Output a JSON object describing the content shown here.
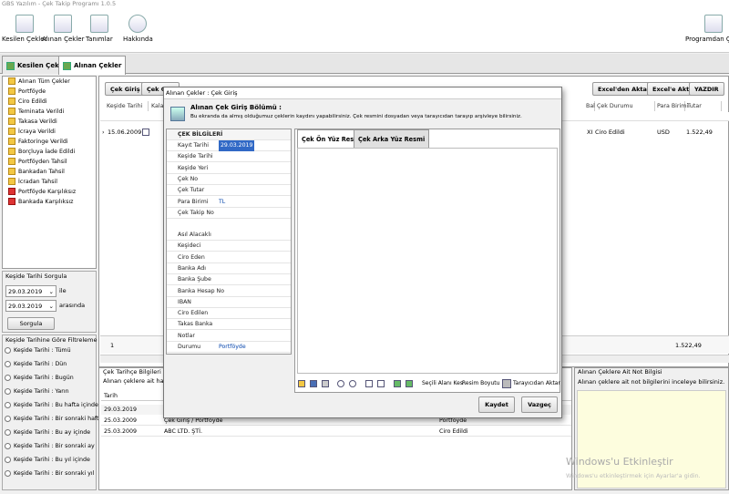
{
  "window": {
    "title": "GBS Yazılım - Çek Takip Programı 1.0.5"
  },
  "ribbon": {
    "kesilen": "Kesilen Çekler",
    "alinan": "Alınan Çekler",
    "tanimlar": "Tanımlar",
    "hakkinda": "Hakkında",
    "exit": "Programdan Çıkış"
  },
  "tabs": [
    "Kesilen Çekler",
    "Alınan Çekler"
  ],
  "tree": [
    "Alınan Tüm Çekler",
    "Portföyde",
    "Ciro Edildi",
    "Teminata Verildi",
    "Takasa Verildi",
    "İcraya Verildi",
    "Faktoringe Verildi",
    "Borçluya İade Edildi",
    "Portföyden Tahsil",
    "Bankadan Tahsil",
    "İcradan Tahsil",
    "Portföyde Karşılıksız",
    "Bankada Karşılıksız"
  ],
  "date_query": {
    "title": "Keşide Tarihi Sorgula",
    "from": "29.03.2019",
    "from_suffix": "ile",
    "to": "29.03.2019",
    "to_suffix": "arasında",
    "button": "Sorgula"
  },
  "filter": {
    "title": "Keşide Tarihine Göre Filtreleme",
    "options": [
      "Keşide Tarihi : Tümü",
      "Keşide Tarihi : Dün",
      "Keşide Tarihi : Bugün",
      "Keşide Tarihi : Yarın",
      "Keşide Tarihi : Bu hafta içinde",
      "Keşide Tarihi : Bir sonraki hafta",
      "Keşide Tarihi : Bu ay içinde",
      "Keşide Tarihi : Bir sonraki ay",
      "Keşide Tarihi : Bu yıl içinde",
      "Keşide Tarihi : Bir sonraki yıl"
    ]
  },
  "toolbar": {
    "cek_giris": "Çek Giriş",
    "cek_guncelle": "Çek Gün",
    "excel_aktar": "Excel'den Aktar",
    "excel_e": "Excel'e Aktar",
    "yazdir": "YAZDIR"
  },
  "grid": {
    "columns": [
      "Keşide Tarihi",
      "Kalan",
      "Bal",
      "Çek Durumu",
      "Para Birimi",
      "Tutar"
    ],
    "row": {
      "tarih": "15.06.2009",
      "x": "XI",
      "durum": "Ciro Edildi",
      "para": "USD",
      "tutar": "1.522,49"
    },
    "footer_count": "1",
    "footer_total": "1.522,49"
  },
  "history": {
    "title": "Çek Tarihçe Bilgileri",
    "info": "Alınan çeklere ait hareketl",
    "col": "Tarih",
    "group": "29.03.2019",
    "rows": [
      {
        "tarih": "25.03.2009",
        "islem": "Çek Giriş / Portföyde",
        "durum": "Portföyde"
      },
      {
        "tarih": "25.03.2009",
        "islem": "ABC LTD. ŞTİ.",
        "durum": "Ciro Edildi"
      }
    ]
  },
  "notes": {
    "title": "Alınan Çeklere Ait Not Bilgisi",
    "info": "Alınan çeklere ait not bilgilerini inceleye bilirsiniz."
  },
  "modal": {
    "title": "Alınan Çekler : Çek Giriş",
    "header": "Alınan Çek Giriş Bölümü :",
    "desc": "Bu ekranda da almış olduğumuz çeklerin kaydını yapabilirsiniz. Çek resmini dosyadan veya tarayıcıdan tarayıp arşivleye bilirsiniz.",
    "section": "ÇEK BİLGİLERİ",
    "fields1": [
      {
        "label": "Kayıt Tarihi",
        "value": "29.03.2019"
      },
      {
        "label": "Keşide Tarihi",
        "value": ""
      },
      {
        "label": "Keşide Yeri",
        "value": ""
      },
      {
        "label": "Çek No",
        "value": ""
      },
      {
        "label": "Çek Tutar",
        "value": ""
      },
      {
        "label": "Para Birimi",
        "value": "TL"
      },
      {
        "label": "Çek Takip No",
        "value": ""
      }
    ],
    "fields2": [
      {
        "label": "Asıl Alacaklı",
        "value": ""
      },
      {
        "label": "Keşideci",
        "value": ""
      },
      {
        "label": "Ciro Eden",
        "value": ""
      },
      {
        "label": "Banka Adı",
        "value": ""
      },
      {
        "label": "Banka Şube",
        "value": ""
      },
      {
        "label": "Banka Hesap No",
        "value": ""
      },
      {
        "label": "IBAN",
        "value": ""
      },
      {
        "label": "Ciro Edilen",
        "value": ""
      },
      {
        "label": "Takas Banka",
        "value": ""
      },
      {
        "label": "Notlar",
        "value": ""
      },
      {
        "label": "Durumu",
        "value": "Portföyde"
      }
    ],
    "img_tabs": [
      "Çek Ön Yüz Resmi",
      "Çek Arka Yüz Resmi"
    ],
    "img_tools": {
      "secili": "Seçili Alanı Kes",
      "boyut": "Resim Boyutu",
      "tarayici": "Tarayıcıdan Aktar"
    },
    "kaydet": "Kaydet",
    "vazgec": "Vazgeç"
  },
  "watermark": {
    "line1": "Windows'u Etkinleştir",
    "line2": "Windows'u etkinleştirmek için Ayarlar'a gidin."
  }
}
